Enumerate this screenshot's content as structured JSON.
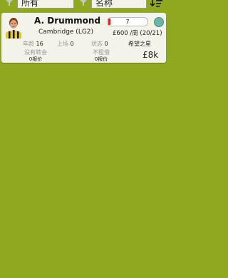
{
  "filters": {
    "left_value": "所有",
    "right_value": "名称"
  },
  "player": {
    "name": "A. Drummond",
    "rating": "7",
    "club": "Cambridge (LG2)",
    "wage": "£600 /周 (20/21)",
    "age_label": "年龄",
    "age": "16",
    "apps_label": "上场",
    "apps": "0",
    "form_label": "状态",
    "form": "0",
    "nickname": "希望之星",
    "transfer_label": "没有转会",
    "transfer_offers": "0报价",
    "loan_label": "不租借",
    "loan_offers": "0报价",
    "value": "£8k"
  },
  "colors": {
    "background": "#8fa81f",
    "card": "#f3f3ea",
    "status_dot": "#6fb3a8",
    "rating_marker": "#d22222"
  }
}
